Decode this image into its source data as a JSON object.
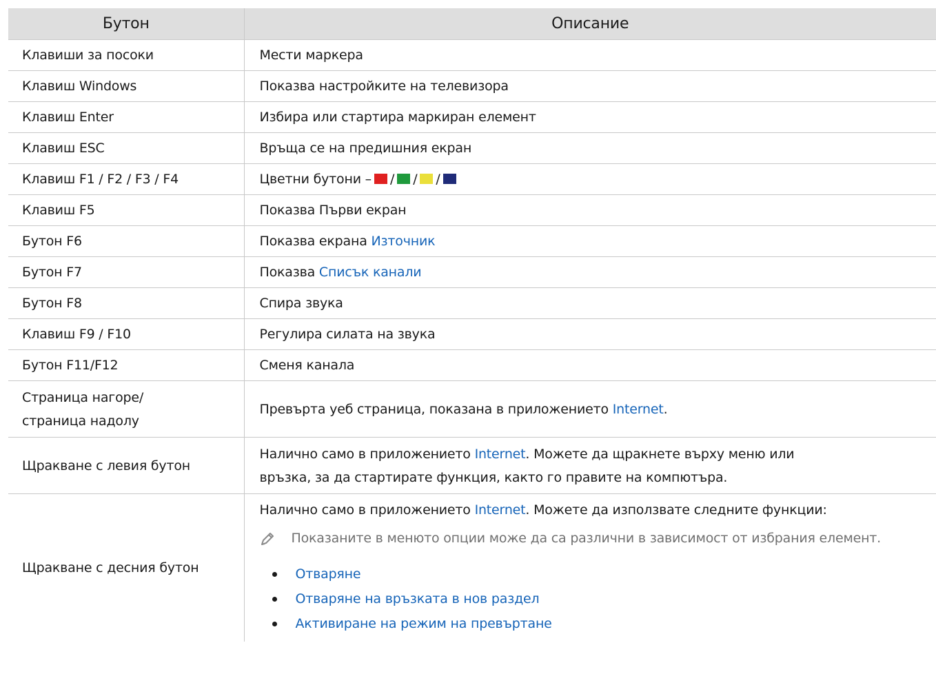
{
  "header": {
    "col1": "Бутон",
    "col2": "Описание"
  },
  "rows": [
    {
      "key": "Клавиши за посоки",
      "desc": "Мести маркера"
    },
    {
      "key": "Клавиш Windows",
      "desc": "Показва настройките на телевизора"
    },
    {
      "key": "Клавиш Enter",
      "desc": "Избира или стартира маркиран елемент"
    },
    {
      "key": "Клавиш ESC",
      "desc": "Връща се на предишния екран"
    },
    {
      "key": "Клавиш F1 / F2 / F3 / F4",
      "desc": "Цветни бутони –",
      "sep": "/"
    },
    {
      "key": "Клавиш F5",
      "desc": "Показва Първи екран"
    },
    {
      "key": "Бутон F6",
      "desc": "Показва екрана ",
      "link": "Източник"
    },
    {
      "key": "Бутон F7",
      "desc": "Показва ",
      "link": "Списък канали"
    },
    {
      "key": "Бутон F8",
      "desc": "Спира звука"
    },
    {
      "key": "Клавиш F9 / F10",
      "desc": "Регулира силата на звука"
    },
    {
      "key": "Бутон F11/F12",
      "desc": "Сменя канала"
    },
    {
      "key_line1": "Страница нагоре/",
      "key_line2": "страница надолу",
      "desc": "Превърта уеб страница, показана в приложението ",
      "link": "Internet",
      "desc_after": "."
    },
    {
      "key": "Щракване с левия бутон",
      "desc": "Налично само в приложението ",
      "link": "Internet",
      "desc_after": ". Можете да щракнете върху меню или",
      "desc_line2": "връзка, за да стартирате функция, както го правите на компютъра."
    },
    {
      "key": "Щракване с десния бутон",
      "desc": "Налично само в приложението ",
      "link": "Internet",
      "desc_after": ". Можете да използвате следните функции:",
      "note": "Показаните в менюто опции може да са различни в зависимост от избрания елемент.",
      "bullets": [
        "Отваряне",
        "Отваряне на връзката в нов раздел",
        "Активиране на режим на превъртане"
      ]
    }
  ],
  "colors": {
    "red": "#e02020",
    "green": "#1f9a3c",
    "yellow": "#eadf3a",
    "blue": "#1f2b78",
    "link": "#1664b8"
  },
  "icons": {
    "note": "pencil-icon"
  }
}
